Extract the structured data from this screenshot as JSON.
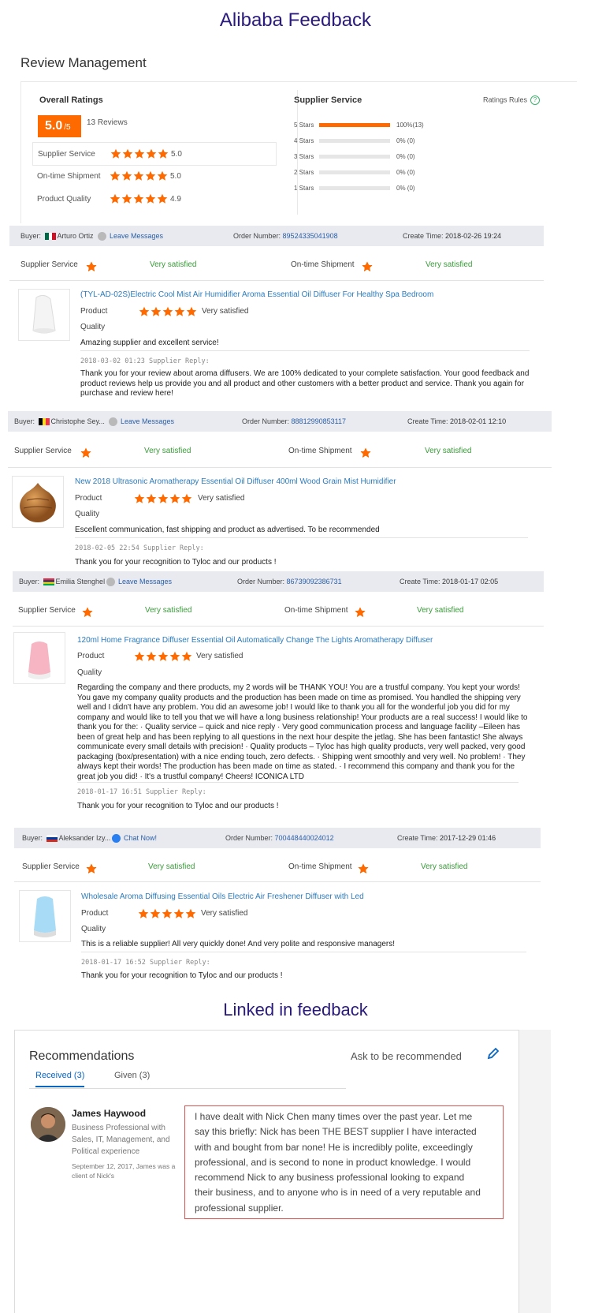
{
  "page_title": "Alibaba Feedback",
  "review_title": "Review Management",
  "overall": {
    "title": "Overall Ratings",
    "score": "5.0",
    "score_suffix": "/5",
    "reviews": "13 Reviews",
    "rows": [
      {
        "label": "Supplier Service",
        "value": "5.0",
        "stars": 5
      },
      {
        "label": "On-time Shipment",
        "value": "5.0",
        "stars": 5
      },
      {
        "label": "Product Quality",
        "value": "4.9",
        "stars": 5
      }
    ]
  },
  "supplier_service": {
    "title": "Supplier Service",
    "rules_label": "Ratings Rules",
    "rules_icon": "help-icon",
    "distribution": [
      {
        "label": "5 Stars",
        "percent": "100%",
        "count": "(13)",
        "fraction": 1.0
      },
      {
        "label": "4 Stars",
        "percent": "0%",
        "count": "(0)",
        "fraction": 0
      },
      {
        "label": "3 Stars",
        "percent": "0%",
        "count": "(0)",
        "fraction": 0
      },
      {
        "label": "2 Stars",
        "percent": "0%",
        "count": "(0)",
        "fraction": 0
      },
      {
        "label": "1 Stars",
        "percent": "0%",
        "count": "(0)",
        "fraction": 0
      }
    ]
  },
  "labels": {
    "buyer": "Buyer:",
    "order_number": "Order Number:",
    "create_time": "Create Time:",
    "supplier_service": "Supplier Service",
    "ontime_shipment": "On-time Shipment",
    "very_satisfied": "Very satisfied",
    "product": "Product",
    "quality": "Quality"
  },
  "feedback": [
    {
      "buyer": "Arturo Ortiz",
      "flag": "mexico-flag",
      "action": "Leave Messages",
      "order": "89524335041908",
      "time": "2018-02-26 19:24",
      "product_title": "(TYL-AD-02S)Electric Cool Mist Air Humidifier Aroma Essential Oil Diffuser For Healthy Spa Bedroom",
      "review": "Amazing supplier and excellent service!",
      "reply_meta": "2018-03-02 01:23  Supplier Reply:",
      "reply_lines": [
        "Thank you for your review about aroma diffusers. We are 100% dedicated to your complete satisfaction. Your good feedback and",
        "product reviews help us provide you and all product and other customers with a better product and service. Thank you again for",
        "purchase and review here!"
      ]
    },
    {
      "buyer": "Christophe Sey...",
      "flag": "belgium-flag",
      "action": "Leave Messages",
      "order": "88812990853117",
      "time": "2018-02-01 12:10",
      "product_title": "New 2018 Ultrasonic Aromatherapy Essential Oil Diffuser 400ml Wood Grain Mist Humidifier",
      "review": "Escellent communication, fast shipping and product as advertised. To be recommended",
      "reply_meta": "2018-02-05 22:54  Supplier Reply:",
      "reply_lines": [
        "Thank you for your recognition to Tyloc and our products !"
      ]
    },
    {
      "buyer": "Emilia Stenghel",
      "flag": "mauritius-flag",
      "action": "Leave Messages",
      "order": "86739092386731",
      "time": "2018-01-17 02:05",
      "product_title": "120ml Home Fragrance Diffuser Essential Oil Automatically Change The Lights Aromatherapy Diffuser",
      "review_lines": [
        "Regarding the company and there products, my 2 words will be THANK YOU! You are a trustful company. You kept your words!",
        "You gave my company quality products and the production has been made on time as promised. You handled the shipping very",
        "well and I didn't have any problem. You did an awesome job! I would like to thank you all for the wonderful job you did for my",
        "company and would like to tell you that we will have a long business relationship! Your products are a real success! I would like to",
        "thank you for the: · Quality service – quick and nice reply · Very good communication process and language facility –Eileen has",
        "been of great help and has been replying to all questions in the next hour despite the jetlag. She has been fantastic! She always",
        "communicate every small details with precision! · Quality products – Tyloc has high quality products, very well packed, very good",
        "packaging (box/presentation) with a nice ending touch, zero defects. · Shipping went smoothly and very well. No problem! · They",
        "always kept their words! The production has been made on time as stated. · I recommend this company and thank you for the",
        "great job you did! · It's a trustful company! Cheers! ICONICA LTD"
      ],
      "reply_meta": "2018-01-17 16:51  Supplier Reply:",
      "reply_lines": [
        "Thank you for your recognition to Tyloc and our products !"
      ]
    },
    {
      "buyer": "Aleksander Izy...",
      "flag": "russia-flag",
      "action": "Chat Now!",
      "order": "700448440024012",
      "time": "2017-12-29 01:46",
      "product_title": "Wholesale Aroma Diffusing Essential Oils Electric Air Freshener Diffuser with Led",
      "review": "This is a reliable supplier! All very quickly done! And very polite and responsive managers!",
      "reply_meta": "2018-01-17 16:52  Supplier Reply:",
      "reply_lines": [
        "Thank you for your recognition to Tyloc and our products !"
      ]
    }
  ],
  "linkedin": {
    "title": "Linked in feedback",
    "card_title": "Recommendations",
    "ask": "Ask to be recommended",
    "tabs": [
      "Received (3)",
      "Given (3)"
    ],
    "person": {
      "name": "James Haywood",
      "headline_lines": [
        "Business Professional with",
        "Sales, IT, Management, and",
        "Political experience"
      ],
      "relation_lines": [
        "September 12, 2017, James was a",
        "client of Nick's"
      ],
      "quote_lines": [
        "I have dealt with Nick Chen many times over the past year. Let me",
        "say this briefly: Nick has been THE BEST supplier I have interacted",
        "with and bought from bar none! He is incredibly polite, exceedingly",
        "professional, and is second to none in product knowledge. I would",
        "recommend Nick to any business professional looking to expand",
        "their business, and to anyone who is in need of a very reputable and",
        "professional supplier."
      ]
    }
  },
  "colors": {
    "accent": "#ff6a00",
    "link": "#2b7bbd",
    "satisfied": "#3a9b3a",
    "header_bg": "#e8eaf0",
    "title": "#2b1a7d"
  }
}
